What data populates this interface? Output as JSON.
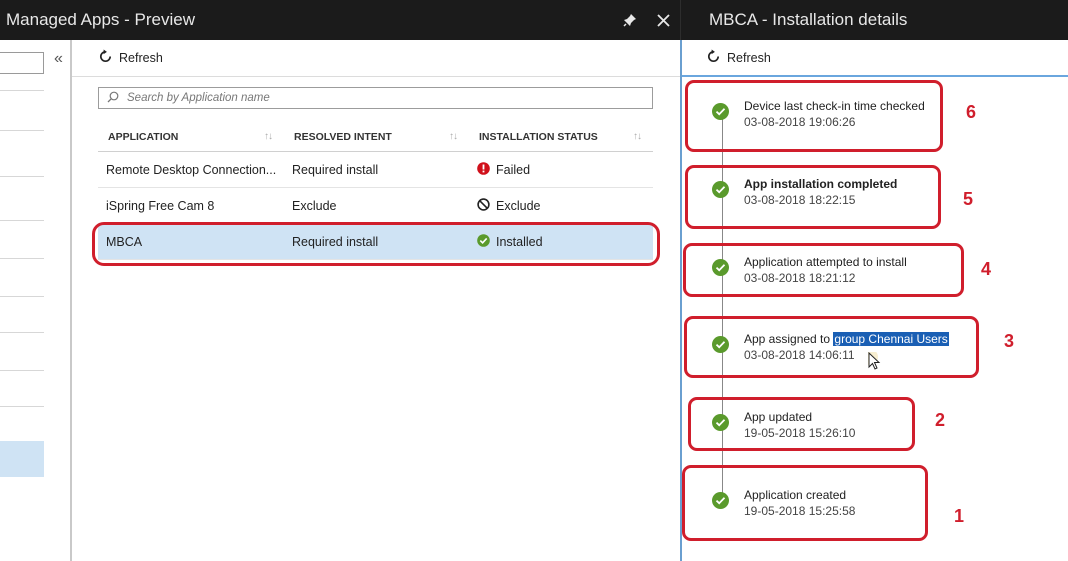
{
  "left_window": {
    "title": "Managed Apps - Preview"
  },
  "right_window": {
    "title": "MBCA - Installation details"
  },
  "icons": {
    "pin": "pin-icon",
    "close": "close-icon",
    "refresh": "refresh-icon",
    "search": "search-icon",
    "collapse": "double-chevron-left-icon"
  },
  "nav": {
    "collapse_glyph": "«"
  },
  "main": {
    "refresh_label": "Refresh",
    "search_placeholder": "Search by Application name",
    "columns": [
      "APPLICATION",
      "RESOLVED INTENT",
      "INSTALLATION STATUS"
    ],
    "rows": [
      {
        "application": "Remote Desktop Connection...",
        "intent": "Required install",
        "status": "Failed",
        "status_icon": "error-icon"
      },
      {
        "application": "iSpring Free Cam 8",
        "intent": "Exclude",
        "status": "Exclude",
        "status_icon": "blocked-icon"
      },
      {
        "application": "MBCA",
        "intent": "Required install",
        "status": "Installed",
        "status_icon": "check-icon"
      }
    ],
    "selected_row": "MBCA"
  },
  "details": {
    "refresh_label": "Refresh",
    "events": [
      {
        "title": "Device last check-in time checked",
        "time": "03-08-2018 19:06:26",
        "bold": false
      },
      {
        "title": "App installation completed",
        "time": "03-08-2018 18:22:15",
        "bold": true
      },
      {
        "title": "Application attempted to install",
        "time": "03-08-2018 18:21:12",
        "bold": false
      },
      {
        "title_prefix": "App assigned to ",
        "title_highlight": "group Chennai Users",
        "time": "03-08-2018 14:06:11",
        "bold": false
      },
      {
        "title": "App updated",
        "time": "19-05-2018 15:26:10",
        "bold": false
      },
      {
        "title": "Application created",
        "time": "19-05-2018 15:25:58",
        "bold": false
      }
    ]
  },
  "annotations": {
    "numbers": [
      "6",
      "5",
      "4",
      "3",
      "2",
      "1"
    ],
    "color": "#d01e2c"
  },
  "colors": {
    "titlebar": "#1b1b1b",
    "selection": "#cfe3f4",
    "success": "#5a9a2c",
    "error": "#d0101b",
    "accent": "#6aa6de"
  }
}
